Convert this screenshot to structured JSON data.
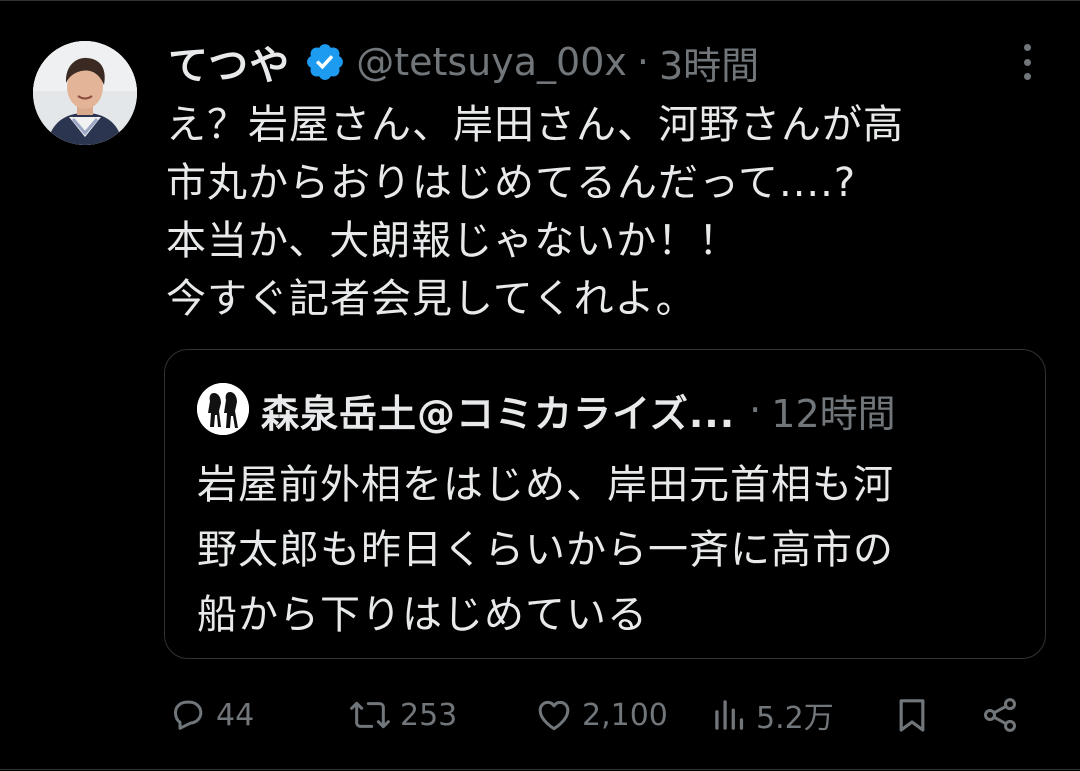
{
  "tweet": {
    "display_name": "てつや",
    "handle": "@tetsuya_00x",
    "separator": "·",
    "time": "3時間",
    "lines": [
      "え？岩屋さん、岸田さん、河野さんが高",
      "市丸からおりはじめてるんだって....?",
      "本当か、大朗報じゃないか！！",
      "今すぐ記者会見してくれよ。"
    ]
  },
  "quote": {
    "display_name": "森泉岳土@コミカライズ...",
    "separator": "·",
    "time": "12時間",
    "lines": [
      "岩屋前外相をはじめ、岸田元首相も河",
      "野太郎も昨日くらいから一斉に高市の",
      "船から下りはじめている"
    ]
  },
  "actions": {
    "replies": "44",
    "reposts": "253",
    "likes": "2,100",
    "views": "5.2万"
  },
  "icons": {
    "avatar": "avatar-photo",
    "verified": "verified-badge-icon",
    "more": "more-vertical-icon",
    "reply": "reply-icon",
    "repost": "repost-icon",
    "like": "heart-icon",
    "views": "views-chart-icon",
    "bookmark": "bookmark-icon",
    "share": "share-icon"
  },
  "colors": {
    "background": "#000000",
    "text": "#e7e9ea",
    "muted": "#71767b",
    "border": "#2f3336",
    "verified": "#1d9bf0"
  }
}
